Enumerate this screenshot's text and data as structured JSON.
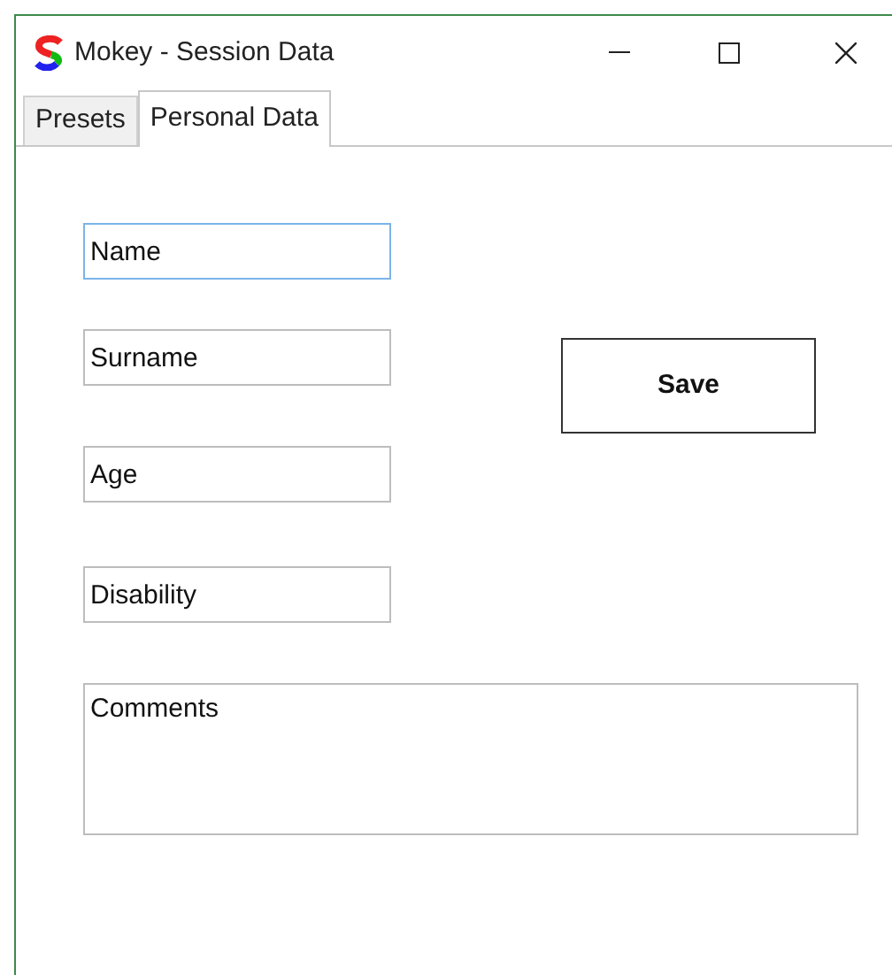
{
  "window": {
    "title": "Mokey - Session Data"
  },
  "tabs": [
    {
      "label": "Presets",
      "selected": false
    },
    {
      "label": "Personal Data",
      "selected": true
    }
  ],
  "fields": [
    {
      "value": "Name",
      "focused": true
    },
    {
      "value": "Surname",
      "focused": false
    },
    {
      "value": "Age",
      "focused": false
    },
    {
      "value": "Disability",
      "focused": false
    }
  ],
  "save_button": {
    "label": "Save"
  },
  "comments": {
    "value": "Comments"
  }
}
